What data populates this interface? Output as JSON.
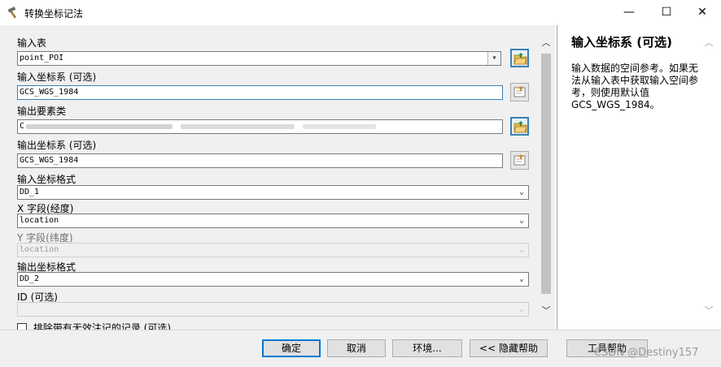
{
  "window": {
    "title": "转换坐标记法",
    "minimize_glyph": "—",
    "maximize_glyph": "☐",
    "close_glyph": "✕"
  },
  "form": {
    "input_table": {
      "label": "输入表",
      "value": "point_POI"
    },
    "input_cs": {
      "label": "输入坐标系 (可选)",
      "value": "GCS_WGS_1984"
    },
    "output_fc": {
      "label": "输出要素类",
      "value": "C"
    },
    "output_cs": {
      "label": "输出坐标系 (可选)",
      "value": "GCS_WGS_1984"
    },
    "input_format": {
      "label": "输入坐标格式",
      "value": "DD_1"
    },
    "x_field": {
      "label": "X 字段(经度)",
      "value": "location"
    },
    "y_field": {
      "label": "Y 字段(纬度)",
      "value": "location"
    },
    "output_format": {
      "label": "输出坐标格式",
      "value": "DD_2"
    },
    "id_field": {
      "label": "ID (可选)",
      "value": ""
    },
    "exclude_invalid": {
      "label": "排除带有无效注记的记录 (可选)",
      "checked": false
    }
  },
  "help": {
    "title": "输入坐标系 (可选)",
    "body": "输入数据的空间参考。如果无法从输入表中获取输入空间参考，则使用默认值 GCS_WGS_1984。"
  },
  "buttons": {
    "ok": "确定",
    "cancel": "取消",
    "environments": "环境...",
    "hide_help": "<< 隐藏帮助",
    "tool_help": "工具帮助"
  },
  "watermark": "CSDN @Destiny157",
  "icons": {
    "app": "hammer-icon",
    "browse": "open-folder-icon",
    "properties": "spatial-reference-icon",
    "dropdown": "chevron-down-icon"
  }
}
